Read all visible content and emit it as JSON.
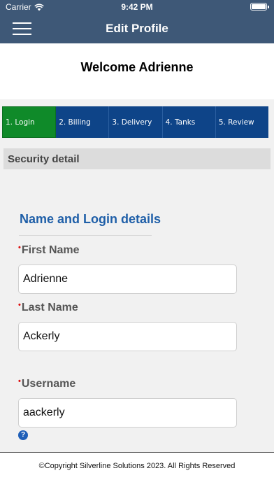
{
  "status_bar": {
    "carrier": "Carrier",
    "time": "9:42 PM"
  },
  "nav": {
    "title": "Edit Profile"
  },
  "welcome": {
    "title": "Welcome Adrienne"
  },
  "steps": [
    {
      "label": "1. Login",
      "active": true
    },
    {
      "label": "2. Billing",
      "active": false
    },
    {
      "label": "3. Delivery",
      "active": false
    },
    {
      "label": "4. Tanks",
      "active": false
    },
    {
      "label": "5. Review",
      "active": false
    }
  ],
  "section": {
    "title": "Security detail"
  },
  "form": {
    "heading": "Name and Login details",
    "first_name": {
      "label": "First Name",
      "value": "Adrienne"
    },
    "last_name": {
      "label": "Last Name",
      "value": "Ackerly"
    },
    "username": {
      "label": "Username",
      "value": "aackerly"
    },
    "required_marker": "•",
    "help_glyph": "?"
  },
  "footer": {
    "copyright": "©Copyright Silverline Solutions 2023. All Rights Reserved"
  },
  "colors": {
    "header": "#3e5877",
    "steps_bg": "#0e4488",
    "step_active": "#0f8a29",
    "heading_blue": "#1f5fa8"
  },
  "icons": {
    "menu": "hamburger-icon",
    "help": "help-icon",
    "wifi": "wifi-icon",
    "battery": "battery-icon"
  }
}
